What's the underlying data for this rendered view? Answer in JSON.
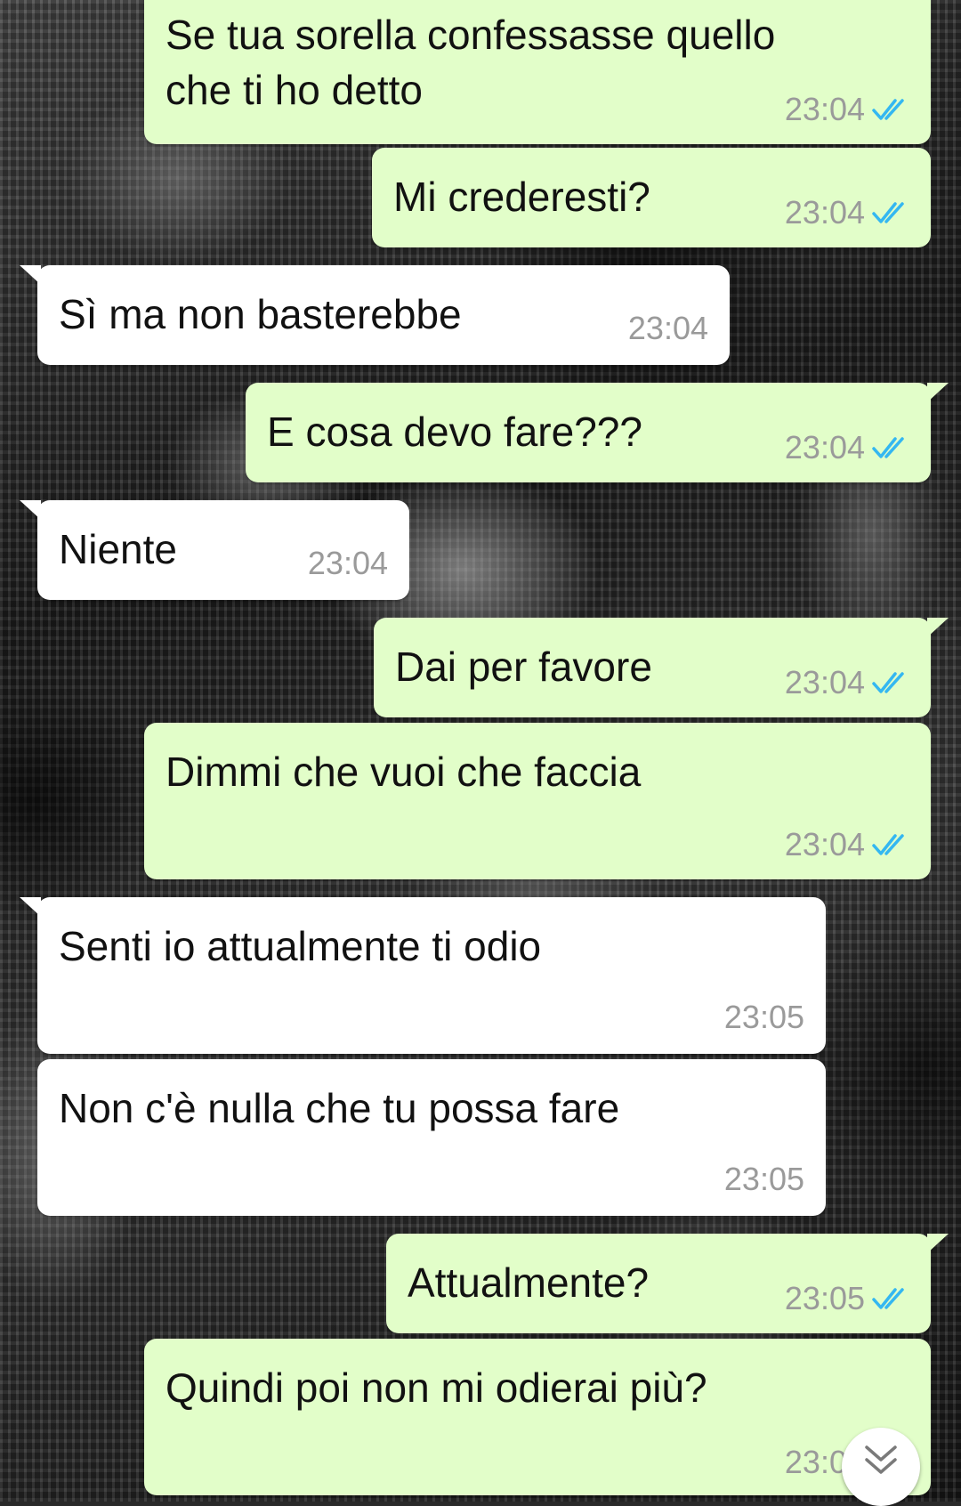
{
  "chat": {
    "messages": [
      {
        "direction": "outgoing",
        "lines": [
          "Se tua sorella confessasse quello",
          "che ti ho detto"
        ],
        "time": "23:04",
        "status": "read"
      },
      {
        "direction": "outgoing",
        "lines": [
          "Mi crederesti?"
        ],
        "time": "23:04",
        "status": "read"
      },
      {
        "direction": "incoming",
        "lines": [
          "Sì ma non basterebbe"
        ],
        "time": "23:04"
      },
      {
        "direction": "outgoing",
        "lines": [
          "E cosa devo fare???"
        ],
        "time": "23:04",
        "status": "read"
      },
      {
        "direction": "incoming",
        "lines": [
          "Niente"
        ],
        "time": "23:04"
      },
      {
        "direction": "outgoing",
        "lines": [
          "Dai per favore"
        ],
        "time": "23:04",
        "status": "read"
      },
      {
        "direction": "outgoing",
        "lines": [
          "Dimmi che vuoi che faccia"
        ],
        "time": "23:04",
        "status": "read"
      },
      {
        "direction": "incoming",
        "lines": [
          "Senti io attualmente ti odio"
        ],
        "time": "23:05"
      },
      {
        "direction": "incoming",
        "lines": [
          "Non c'è nulla che tu possa fare"
        ],
        "time": "23:05"
      },
      {
        "direction": "outgoing",
        "lines": [
          "Attualmente?"
        ],
        "time": "23:05",
        "status": "read"
      },
      {
        "direction": "outgoing",
        "lines": [
          "Quindi poi non mi odierai più?"
        ],
        "time": "23:05",
        "status": "read"
      }
    ]
  },
  "icons": {
    "read_receipt": "double-check-icon",
    "scroll_down": "double-chevron-down-icon"
  },
  "colors": {
    "outgoing_bubble": "#e2fec9",
    "incoming_bubble": "#ffffff",
    "read_tick": "#34b7f1",
    "timestamp": "#9a9a9a"
  }
}
